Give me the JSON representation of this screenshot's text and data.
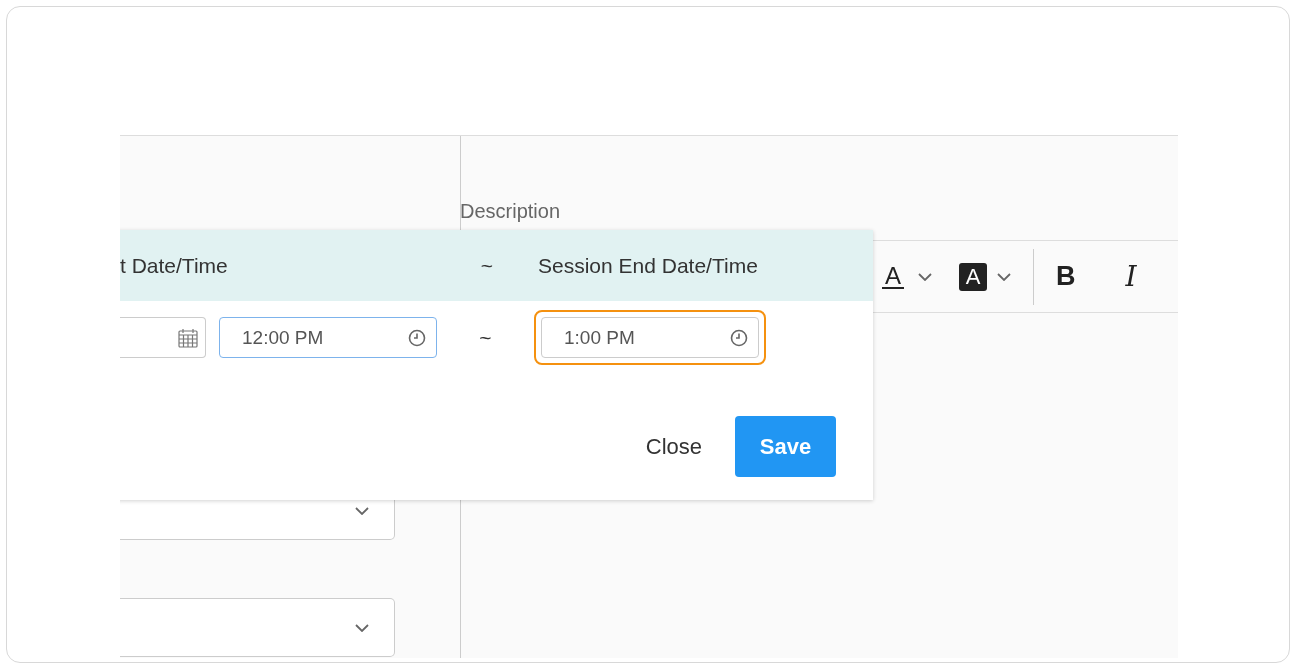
{
  "page": {
    "description_label": "Description",
    "left_selects": [
      {
        "kind": "select"
      },
      {
        "kind": "select"
      }
    ],
    "editor_toolbar": [
      {
        "kind": "text-color",
        "label": "A"
      },
      {
        "kind": "caret"
      },
      {
        "kind": "highlight-color",
        "label": "A"
      },
      {
        "kind": "caret"
      },
      {
        "kind": "separator"
      },
      {
        "kind": "bold",
        "label": "B"
      },
      {
        "kind": "italic",
        "label": "I"
      }
    ]
  },
  "session_popup": {
    "header": {
      "start_label": "t Date/Time",
      "separator": "~",
      "end_label": "Session End Date/Time"
    },
    "start_time": {
      "value": "12:00 PM",
      "focused": true
    },
    "separator": "~",
    "end_time": {
      "value": "1:00 PM",
      "highlighted": true
    },
    "buttons": [
      {
        "label": "Close",
        "kind": "text"
      },
      {
        "label": "Save",
        "kind": "primary"
      }
    ]
  }
}
